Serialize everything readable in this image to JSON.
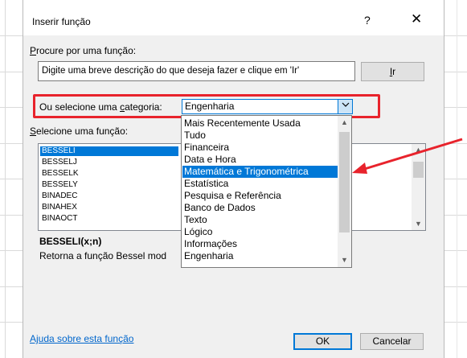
{
  "dialog": {
    "title": "Inserir função",
    "help_glyph": "?",
    "close_glyph": "✕"
  },
  "search": {
    "label_prefix": "",
    "label_accel": "P",
    "label_rest": "rocure por uma função:",
    "value": "Digite uma breve descrição do que deseja fazer e clique em 'Ir'",
    "go_accel": "I",
    "go_rest": "r"
  },
  "category": {
    "label_prefix": "Ou selecione uma ",
    "label_accel": "c",
    "label_rest": "ategoria:",
    "selected": "Engenharia",
    "options": [
      "Mais Recentemente Usada",
      "Tudo",
      "Financeira",
      "Data e Hora",
      "Matemática e Trigonométrica",
      "Estatística",
      "Pesquisa e Referência",
      "Banco de Dados",
      "Texto",
      "Lógico",
      "Informações",
      "Engenharia"
    ],
    "highlighted_index": 4
  },
  "functions": {
    "label_accel": "S",
    "label_rest": "elecione uma função:",
    "items": [
      "BESSELI",
      "BESSELJ",
      "BESSELK",
      "BESSELY",
      "BINADEC",
      "BINAHEX",
      "BINAOCT"
    ],
    "selected_index": 0
  },
  "selected_function": {
    "signature": "BESSELI(x;n)",
    "description": "Retorna a função Bessel mod"
  },
  "footer": {
    "help_link": "Ajuda sobre esta função",
    "ok_label": "OK",
    "cancel_label": "Cancelar"
  },
  "colors": {
    "highlight": "#0078d7",
    "annotation_red": "#e8232c",
    "link": "#0066cc"
  }
}
